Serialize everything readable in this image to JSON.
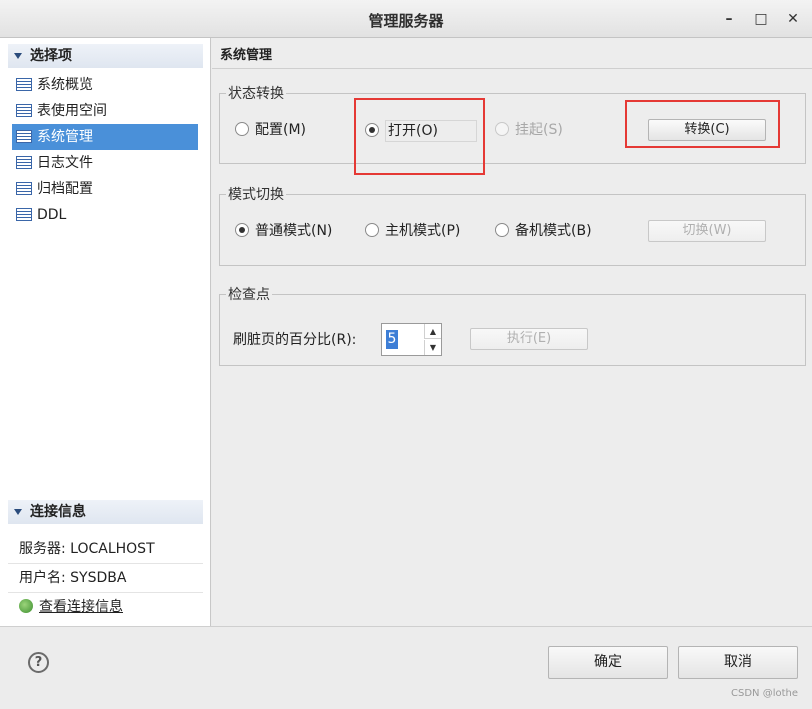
{
  "window": {
    "title": "管理服务器",
    "minimize": "–",
    "maximize": "□",
    "close": "✕"
  },
  "sidebar": {
    "header": "选择项",
    "items": [
      {
        "label": "系统概览",
        "selected": false
      },
      {
        "label": "表使用空间",
        "selected": false
      },
      {
        "label": "系统管理",
        "selected": true
      },
      {
        "label": "日志文件",
        "selected": false
      },
      {
        "label": "归档配置",
        "selected": false
      },
      {
        "label": "DDL",
        "selected": false
      }
    ]
  },
  "connection": {
    "header": "连接信息",
    "server": "服务器: LOCALHOST",
    "user": "用户名: SYSDBA",
    "link": "查看连接信息"
  },
  "main": {
    "title": "系统管理",
    "state": {
      "legend": "状态转换",
      "options": [
        {
          "label": "配置(M)",
          "checked": false,
          "enabled": true
        },
        {
          "label": "打开(O)",
          "checked": true,
          "enabled": true
        },
        {
          "label": "挂起(S)",
          "checked": false,
          "enabled": false
        }
      ],
      "button": "转换(C)"
    },
    "mode": {
      "legend": "模式切换",
      "options": [
        {
          "label": "普通模式(N)",
          "checked": true
        },
        {
          "label": "主机模式(P)",
          "checked": false
        },
        {
          "label": "备机模式(B)",
          "checked": false
        }
      ],
      "button": "切换(W)"
    },
    "checkpoint": {
      "legend": "检查点",
      "label": "刷脏页的百分比(R):",
      "value": "5",
      "button": "执行(E)"
    }
  },
  "footer": {
    "help": "?",
    "ok": "确定",
    "cancel": "取消"
  },
  "watermark": "CSDN @lothe",
  "colors": {
    "selection": "#4a90d9",
    "highlight_box": "#e53935"
  }
}
